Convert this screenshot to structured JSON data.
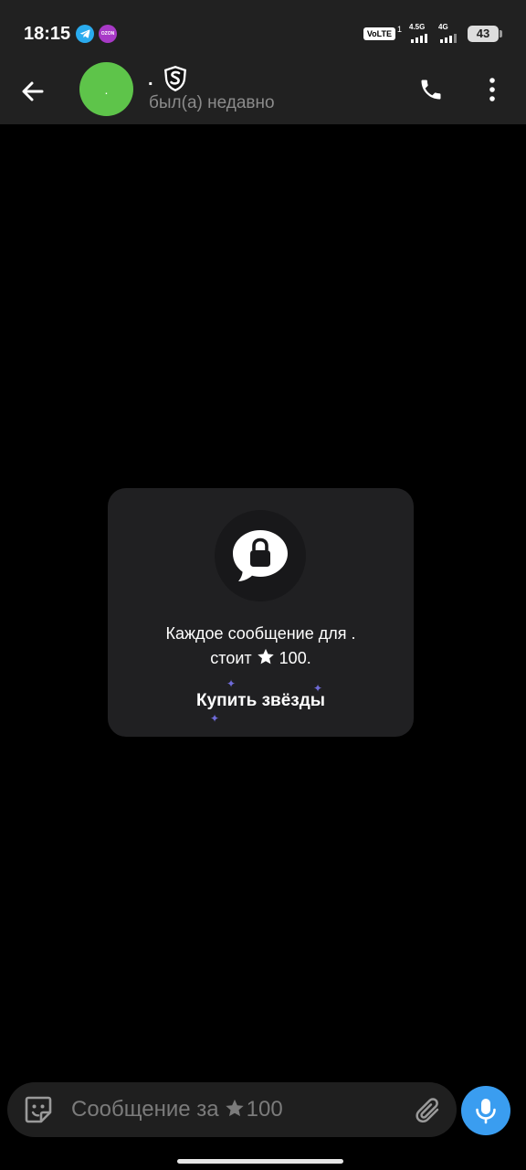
{
  "status_bar": {
    "time": "18:15",
    "volte": "VoLTE",
    "sim1_label": "1",
    "net1": "4.5G",
    "net2": "4G",
    "battery": "43",
    "apps": [
      "telegram-notification-icon",
      "ozon-notification-icon"
    ],
    "ozon_label": "OZON"
  },
  "header": {
    "avatar_text": ".",
    "name": ".",
    "status": "был(а) недавно",
    "icons": [
      "back-arrow-icon",
      "shield-s-emoji-status-icon",
      "phone-icon",
      "more-vertical-icon"
    ]
  },
  "paid_card": {
    "line1": "Каждое сообщение для .",
    "line2_prefix": "стоит",
    "line2_price": "100.",
    "buy_label": "Купить звёзды",
    "icons": [
      "lock-bubble-icon",
      "star-icon"
    ]
  },
  "input": {
    "placeholder_prefix": "Сообщение за",
    "price": "100",
    "icons": [
      "sticker-icon",
      "star-icon",
      "paperclip-icon",
      "microphone-icon"
    ]
  },
  "colors": {
    "background": "#000000",
    "bar": "#212121",
    "card": "#202022",
    "avatar": "#5ec44a",
    "mic_button": "#3a9df0",
    "muted_text": "#8b8b8b",
    "sparkle": "#6f6bd8"
  }
}
